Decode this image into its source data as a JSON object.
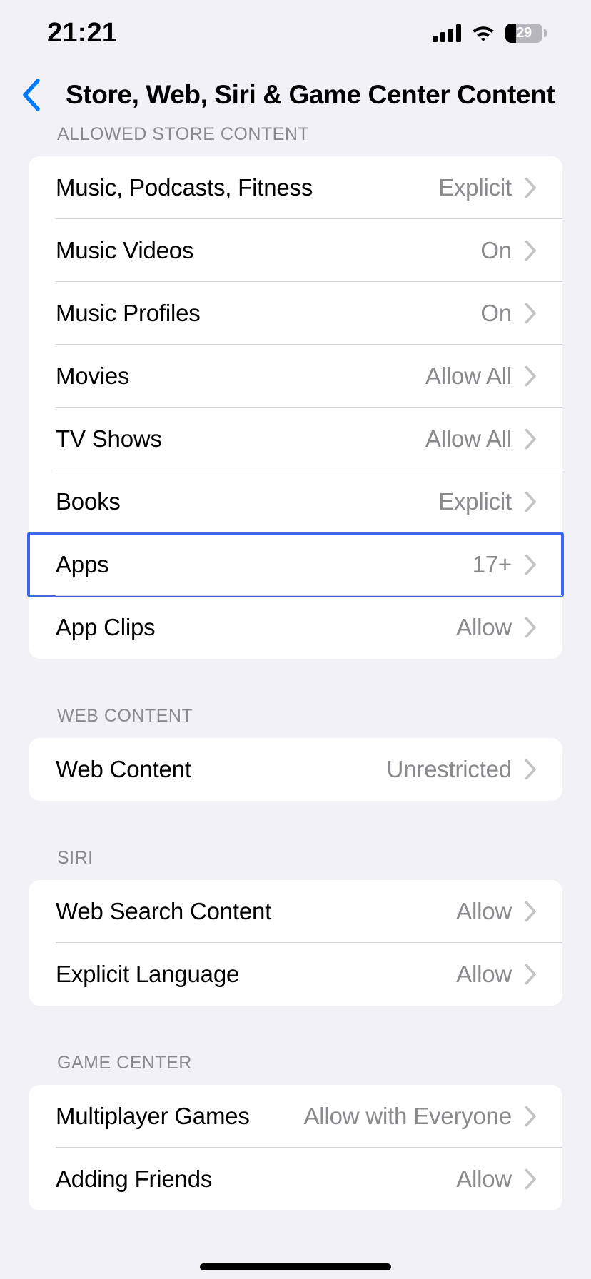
{
  "statusbar": {
    "time": "21:21",
    "battery_level": "29",
    "signal_icon": "cellular-signal-icon",
    "wifi_icon": "wifi-icon",
    "battery_icon": "battery-icon"
  },
  "navbar": {
    "back_icon": "chevron-left-icon",
    "title": "Store, Web, Siri & Game Center Content"
  },
  "colors": {
    "accent_blue": "#007AFF",
    "highlight_blue": "#3D66F2",
    "background": "#F2F2F6",
    "card": "#FFFFFF",
    "secondary_text": "#8A8A8E"
  },
  "sections": [
    {
      "header": "ALLOWED STORE CONTENT",
      "rows": [
        {
          "label": "Music, Podcasts, Fitness",
          "value": "Explicit",
          "highlighted": false
        },
        {
          "label": "Music Videos",
          "value": "On",
          "highlighted": false
        },
        {
          "label": "Music Profiles",
          "value": "On",
          "highlighted": false
        },
        {
          "label": "Movies",
          "value": "Allow All",
          "highlighted": false
        },
        {
          "label": "TV Shows",
          "value": "Allow All",
          "highlighted": false
        },
        {
          "label": "Books",
          "value": "Explicit",
          "highlighted": false
        },
        {
          "label": "Apps",
          "value": "17+",
          "highlighted": true
        },
        {
          "label": "App Clips",
          "value": "Allow",
          "highlighted": false
        }
      ]
    },
    {
      "header": "WEB CONTENT",
      "rows": [
        {
          "label": "Web Content",
          "value": "Unrestricted",
          "highlighted": false
        }
      ]
    },
    {
      "header": "SIRI",
      "rows": [
        {
          "label": "Web Search Content",
          "value": "Allow",
          "highlighted": false
        },
        {
          "label": "Explicit Language",
          "value": "Allow",
          "highlighted": false
        }
      ]
    },
    {
      "header": "GAME CENTER",
      "rows": [
        {
          "label": "Multiplayer Games",
          "value": "Allow with Everyone",
          "highlighted": false
        },
        {
          "label": "Adding Friends",
          "value": "Allow",
          "highlighted": false
        }
      ]
    }
  ]
}
